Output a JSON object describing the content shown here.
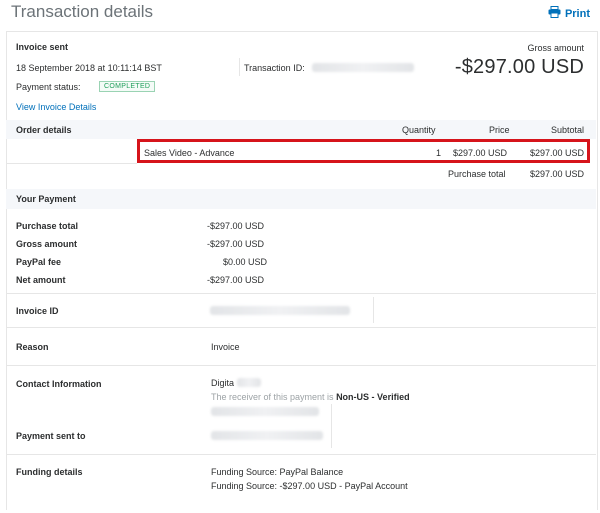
{
  "header": {
    "title": "Transaction details",
    "print_label": "Print"
  },
  "summary": {
    "status_heading": "Invoice sent",
    "date": "18 September 2018 at 10:11:14 BST",
    "transaction_id_label": "Transaction ID:",
    "gross_amount_label": "Gross amount",
    "gross_amount_value": "-$297.00 USD",
    "payment_status_label": "Payment status:",
    "payment_status_value": "COMPLETED",
    "view_invoice_link": "View Invoice Details"
  },
  "order": {
    "heading": "Order details",
    "columns": {
      "quantity": "Quantity",
      "price": "Price",
      "subtotal": "Subtotal"
    },
    "items": [
      {
        "name": "Sales Video - Advance",
        "quantity": "1",
        "price": "$297.00 USD",
        "subtotal": "$297.00 USD"
      }
    ],
    "purchase_total_label": "Purchase total",
    "purchase_total_value": "$297.00 USD"
  },
  "payment": {
    "heading": "Your Payment",
    "rows": [
      {
        "label": "Purchase total",
        "value": "-$297.00 USD"
      },
      {
        "label": "Gross amount",
        "value": "-$297.00 USD"
      },
      {
        "label": "PayPal fee",
        "value": "$0.00 USD"
      },
      {
        "label": "Net amount",
        "value": "-$297.00 USD"
      }
    ],
    "invoice_id_label": "Invoice ID",
    "reason_label": "Reason",
    "reason_value": "Invoice",
    "contact_label": "Contact Information",
    "contact_name": "Digita",
    "receiver_note_prefix": "The receiver of this payment is ",
    "receiver_note_status": "Non-US - Verified",
    "payment_sent_to_label": "Payment sent to",
    "funding_label": "Funding details",
    "funding_line1": "Funding Source: PayPal Balance",
    "funding_line2": "Funding Source: -$297.00 USD - PayPal Account"
  },
  "colors": {
    "link": "#0070ba",
    "highlight": "#d6141b",
    "completed": "#1f9e5a"
  }
}
